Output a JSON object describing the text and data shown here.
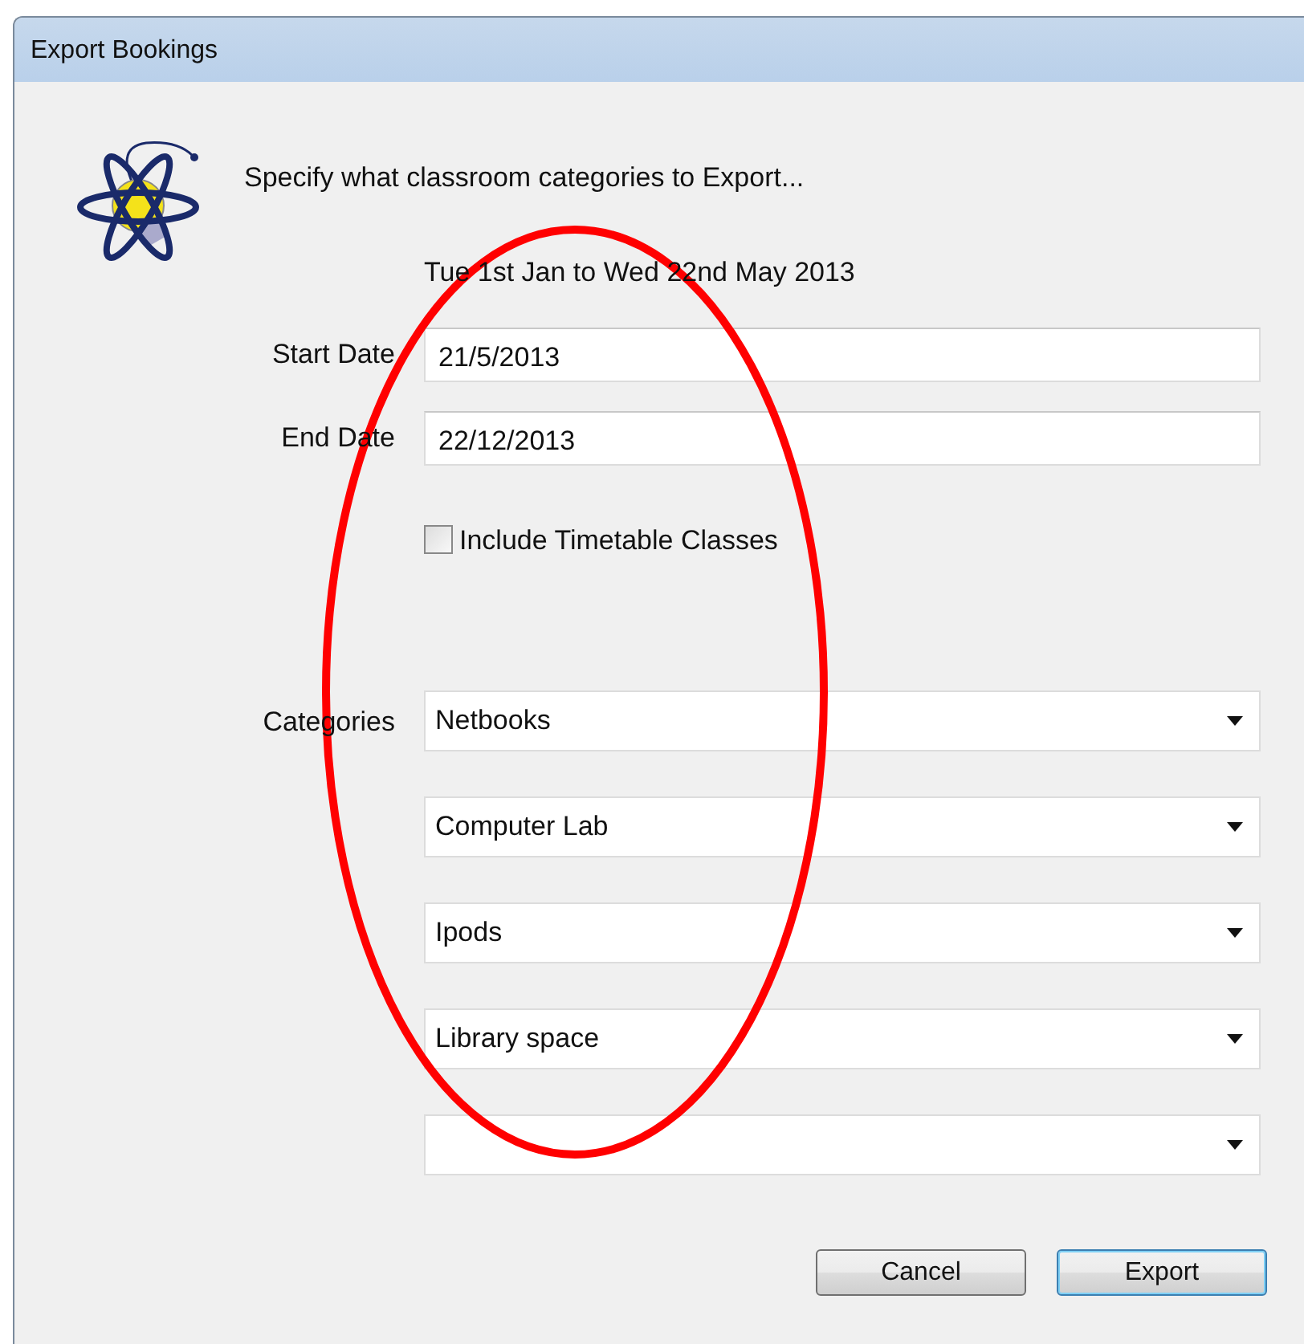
{
  "window": {
    "title": "Export Bookings"
  },
  "instruction": "Specify what classroom categories to Export...",
  "date_range": "Tue 1st Jan  to  Wed 22nd May 2013",
  "fields": [
    {
      "label": "Start Date",
      "value": "21/5/2013"
    },
    {
      "label": "End Date",
      "value": "22/12/2013"
    }
  ],
  "include_timetable": {
    "label": "Include Timetable Classes",
    "checked": false
  },
  "categories": {
    "label": "Categories",
    "selects": [
      {
        "kind": "chosen",
        "value": "Netbooks"
      },
      {
        "kind": "chosen",
        "value": "Computer Lab"
      },
      {
        "kind": "chosen",
        "value": "Ipods"
      },
      {
        "kind": "chosen",
        "value": "Library space"
      },
      {
        "kind": "blank"
      }
    ]
  },
  "buttons": [
    {
      "label": "Cancel",
      "focused": false
    },
    {
      "label": "Export",
      "focused": true
    }
  ],
  "annotation": {
    "kind": "ellipse"
  }
}
